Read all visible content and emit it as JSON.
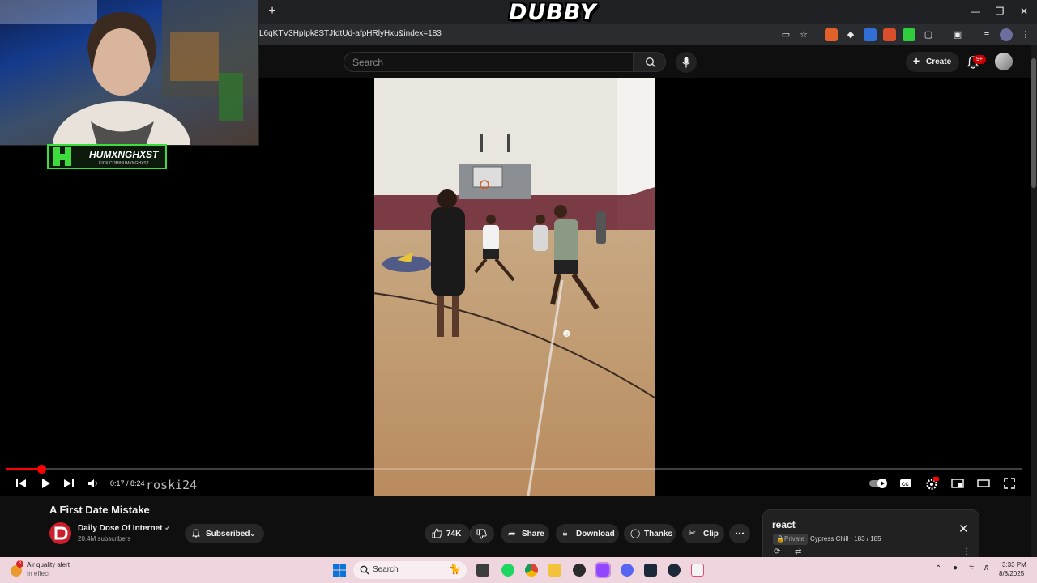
{
  "app": {
    "logo_text": "DUBBY"
  },
  "browser": {
    "url": "L6qKTV3HpIpk8STJfdtUd-afpHRlyHxu&index=183",
    "new_tab": "+",
    "window_controls": [
      "minimize-icon",
      "restore-icon",
      "close-icon"
    ]
  },
  "youtube_header": {
    "search_placeholder": "Search",
    "create_label": "Create",
    "notification_badge": "9+"
  },
  "player": {
    "current_time": "0:17",
    "duration": "8:24",
    "time_display": "0:17 / 8:24",
    "progress_fraction": 0.034,
    "overlay_username": "roski24_"
  },
  "video": {
    "title": "A First Date Mistake",
    "channel_name": "Daily Dose Of Internet",
    "subscribers": "20.4M subscribers",
    "subscribed_label": "Subscribed",
    "likes": "74K",
    "share_label": "Share",
    "download_label": "Download",
    "thanks_label": "Thanks",
    "clip_label": "Clip"
  },
  "playlist": {
    "title": "react",
    "privacy": "Private",
    "owner": "Cypress Chill",
    "position": "183 / 185",
    "info": "Cypress Chill · 183 / 185"
  },
  "streamer": {
    "name": "HUMXNGHXST",
    "link": "KICK.COM/HUMXNGHXST"
  },
  "taskbar": {
    "weather_title": "Air quality alert",
    "weather_sub": "In effect",
    "weather_badge": "3",
    "search_label": "Search",
    "time": "3:33 PM",
    "date": "8/8/2025"
  },
  "colors": {
    "accent_red": "#ff0000",
    "streamer_green": "#3ddc3d",
    "taskbar": "#efd5dd"
  }
}
